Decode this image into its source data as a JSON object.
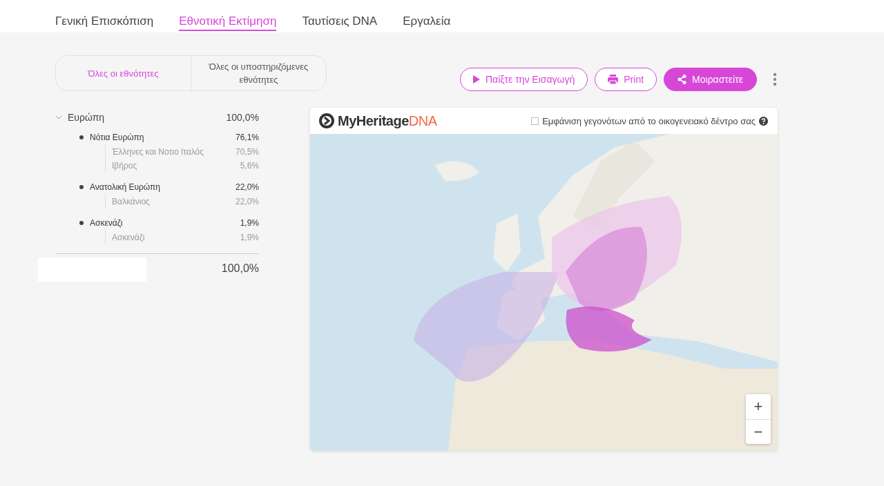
{
  "tabs": [
    {
      "label": "Γενική Επισκόπιση",
      "selected": false
    },
    {
      "label": "Εθνοτική Εκτίμηση",
      "selected": true
    },
    {
      "label": "Ταυτίσεις DNA",
      "selected": false
    },
    {
      "label": "Εργαλεία",
      "selected": false
    }
  ],
  "filter": [
    {
      "label": "Όλες οι εθνότητες",
      "selected": true
    },
    {
      "label": "Όλες οι υποστηριζόμενες εθνότητες",
      "selected": false
    }
  ],
  "actions": [
    {
      "kind": "play",
      "label": "Παίξτε την Εισαγωγή"
    },
    {
      "kind": "print",
      "label": "Print"
    },
    {
      "kind": "share",
      "label": "Μοιραστείτε"
    }
  ],
  "regions": [
    {
      "name": "Ευρώπη",
      "percent": "100,0%",
      "expanded": true,
      "children": [
        {
          "name": "Νότια Ευρώπη",
          "percent": "76,1%",
          "children": [
            {
              "name": "Έλληνες και Νοτιο Ιταλός",
              "percent": "70,5%"
            },
            {
              "name": "Ιβήρος",
              "percent": "5,6%"
            }
          ]
        },
        {
          "name": "Ανατολική Ευρώπη",
          "percent": "22,0%",
          "children": [
            {
              "name": "Βαλκάνιος",
              "percent": "22,0%"
            }
          ]
        },
        {
          "name": "Ασκενάζι",
          "percent": "1,9%",
          "children": [
            {
              "name": "Ασκενάζι",
              "percent": "1,9%"
            }
          ]
        }
      ]
    }
  ],
  "total": "100,0%",
  "map": {
    "logo": "MyHeritage",
    "logo_suffix": "DNA",
    "tree_events": {
      "label": "Εμφάνιση γεγονότων από το οικογενειακό δέντρο σας",
      "checked": false
    },
    "zoom_in": "+",
    "zoom_out": "−"
  }
}
